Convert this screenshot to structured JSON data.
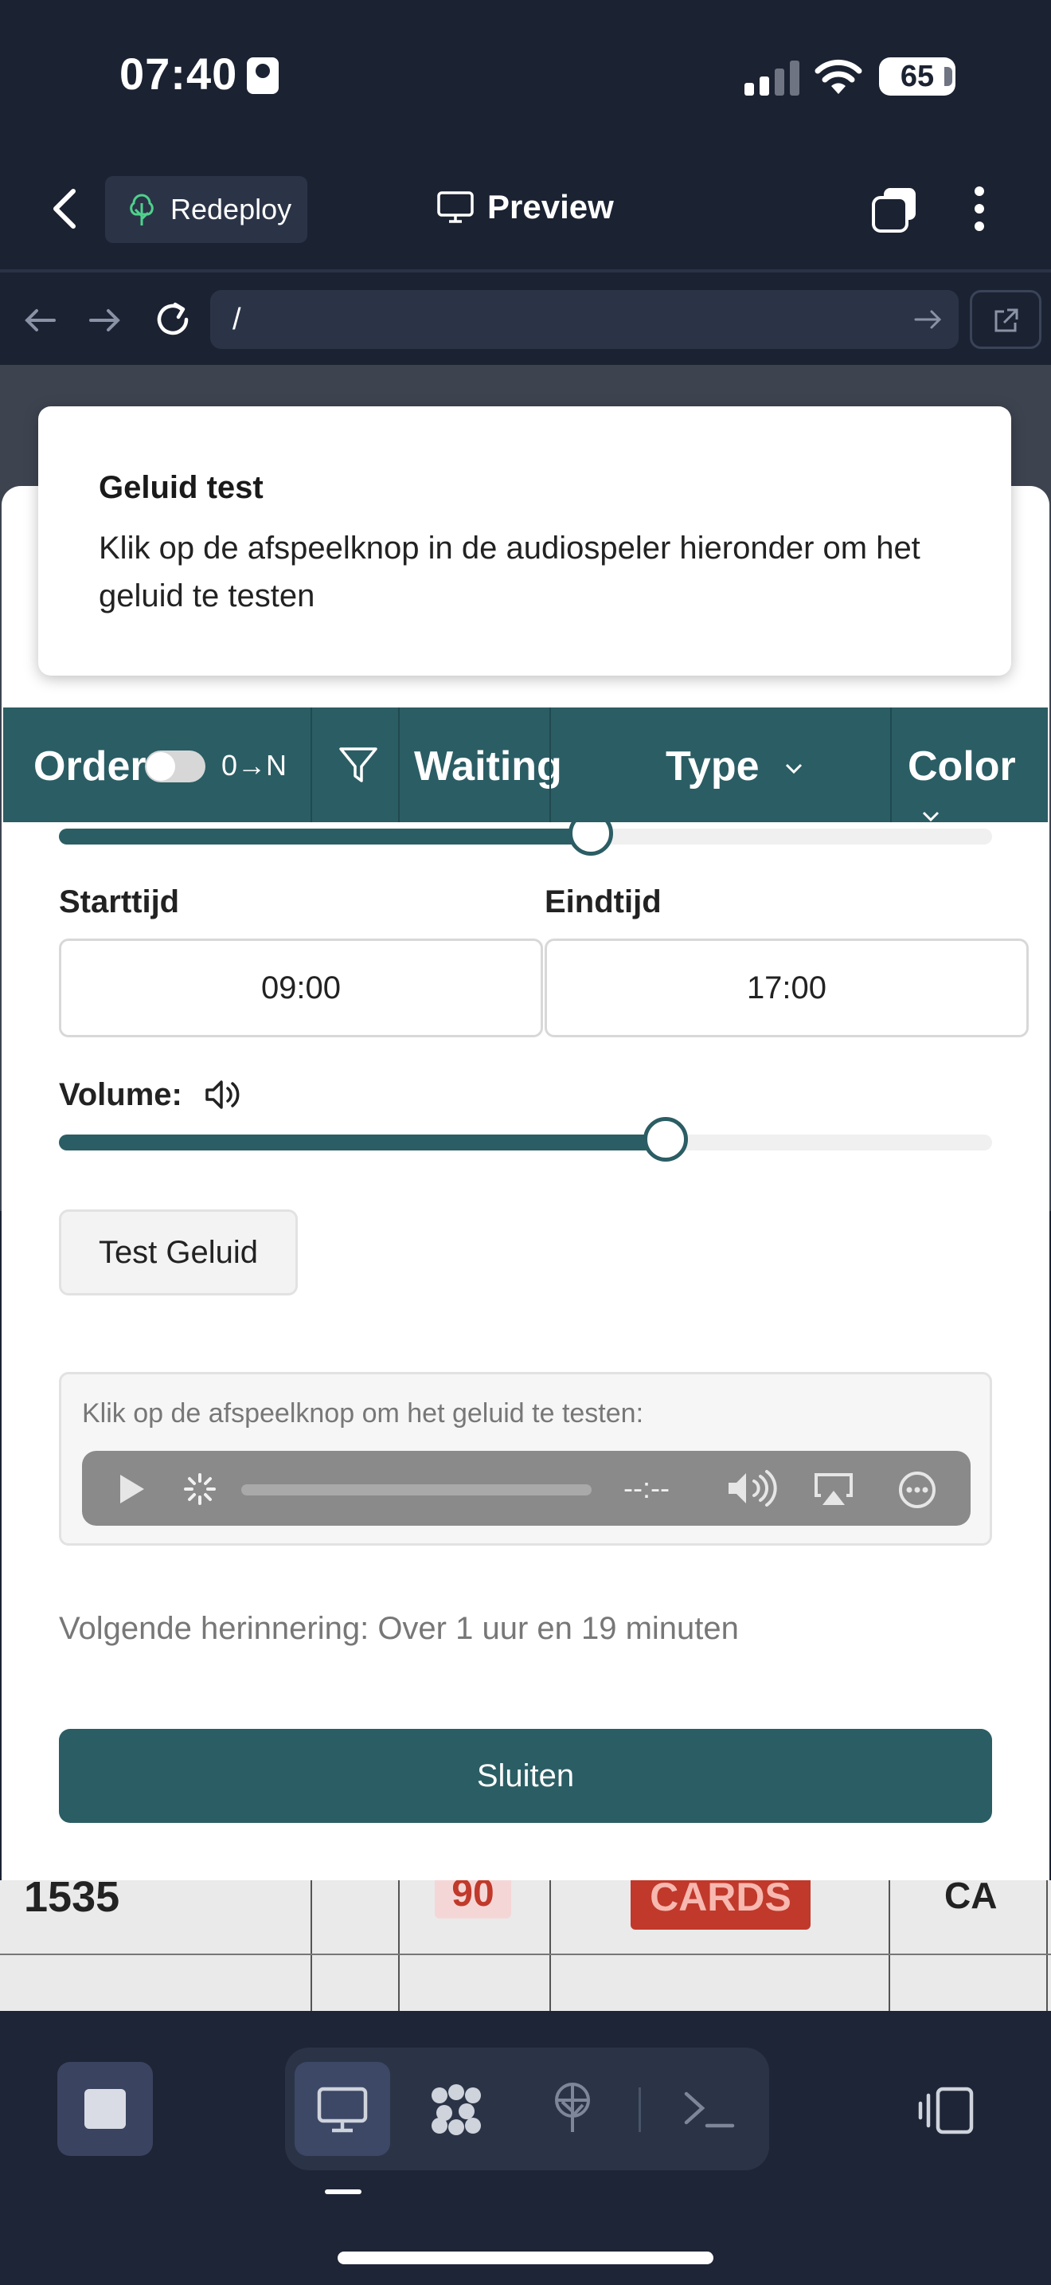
{
  "status_bar": {
    "time": "07:40",
    "battery": "65"
  },
  "top_nav": {
    "redeploy_label": "Redeploy",
    "preview_label": "Preview"
  },
  "browser": {
    "url": "/"
  },
  "toolbar": {
    "order_label": "Order",
    "order_toggle": "0→N",
    "waiting_label": "Waiting",
    "type_label": "Type",
    "color_label": "Color"
  },
  "toast": {
    "title": "Geluid test",
    "message": "Klik op de afspeelknop in de audiospeler hieronder om het geluid te testen"
  },
  "settings": {
    "start_label": "Starttijd",
    "start_value": "09:00",
    "end_label": "Eindtijd",
    "end_value": "17:00",
    "volume_label": "Volume:",
    "time_slider_fraction": 0.57,
    "volume_fraction": 0.65,
    "test_button": "Test Geluid",
    "audio_hint": "Klik op de afspeelknop om het geluid te testen:",
    "audio_time": "--:--",
    "next_reminder": "Volgende herinnering: Over 1 uur en 19 minuten",
    "close_button": "Sluiten"
  },
  "background_table": {
    "row_number": "1535",
    "waiting_value": "90",
    "type_value": "CARDS",
    "color_value": "CA"
  },
  "colors": {
    "accent": "#2b5d64",
    "dark_bg": "#1b2232",
    "panel_bg": "#2b3447"
  }
}
